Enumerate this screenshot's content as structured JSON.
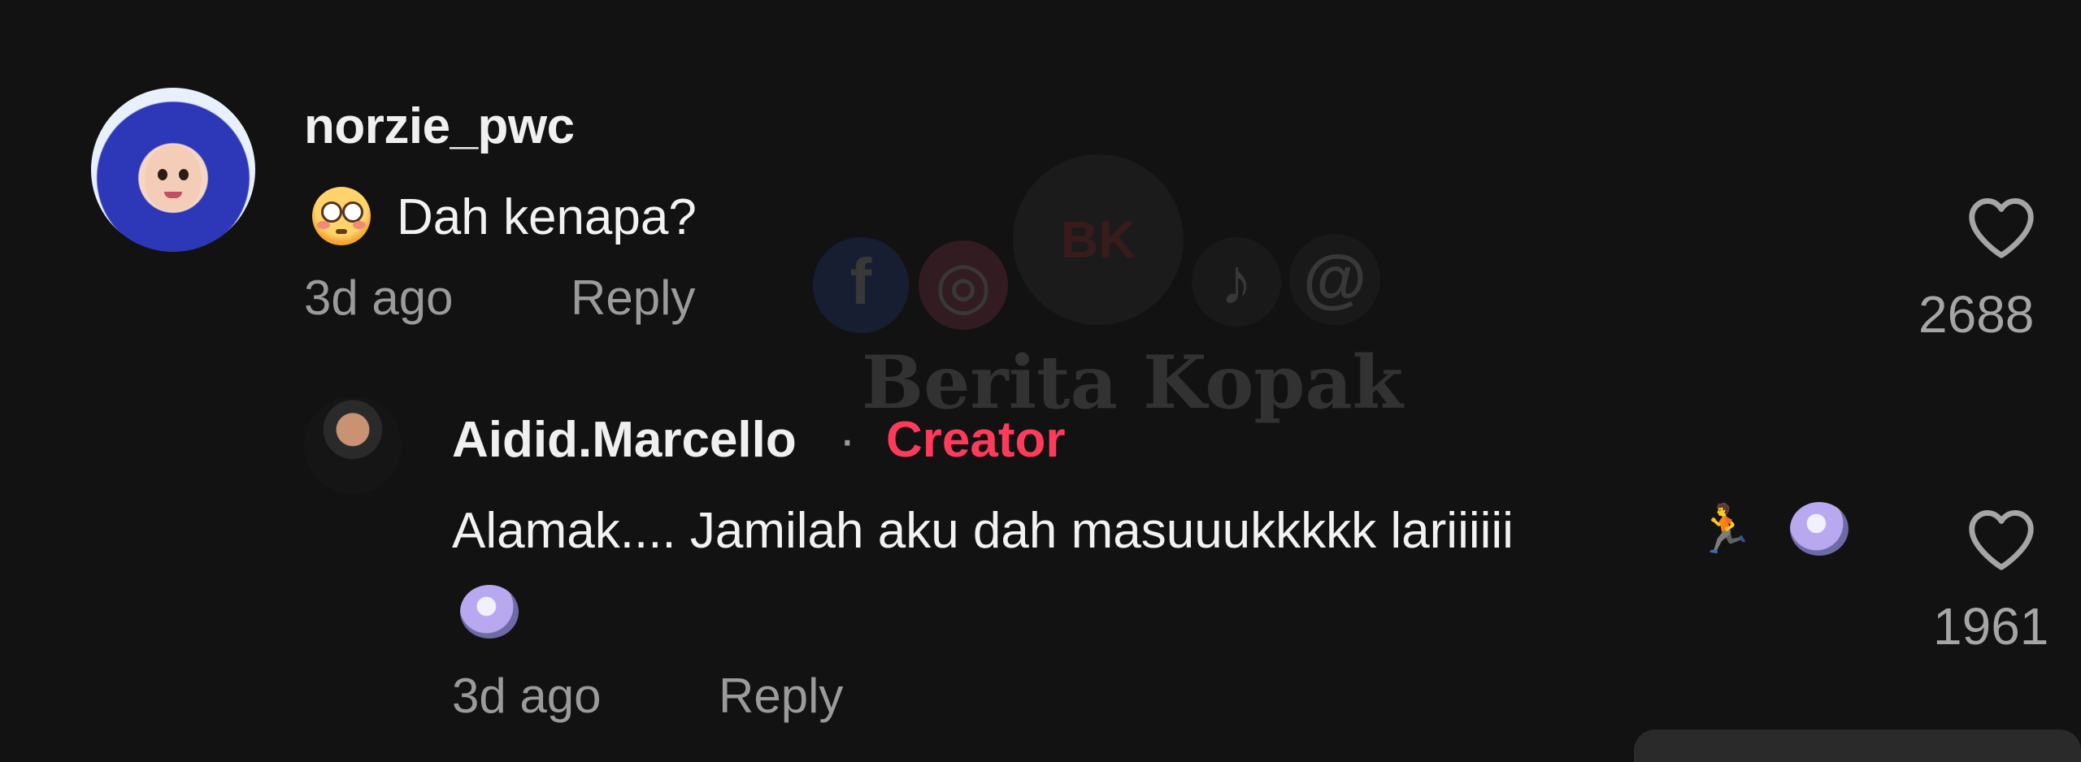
{
  "comments": [
    {
      "username": "norzie_pwc",
      "avatar_icon": "avatar-hijab-cartoon",
      "emoji": "flushed-face-emoji",
      "text": "Dah kenapa?",
      "time": "3d ago",
      "reply_label": "Reply",
      "likes": "2688"
    }
  ],
  "replies": [
    {
      "username": "Aidid.Marcello",
      "separator": "·",
      "badge": "Creator",
      "badge_color": "#ff3b5c",
      "text": "Alamak.... Jamilah aku dah masuuukkkkk lariiiiii",
      "emojis": [
        "person-running-emoji",
        "dashing-away-emoji",
        "dashing-away-emoji"
      ],
      "time": "3d ago",
      "reply_label": "Reply",
      "likes": "1961"
    }
  ],
  "watermark": {
    "brand": "Berita Kopak",
    "logo_text": "BK",
    "icons": [
      "facebook-icon",
      "instagram-icon",
      "tiktok-icon",
      "threads-icon"
    ]
  },
  "theme": {
    "background": "#121212",
    "muted_text": "#9b9b9b"
  }
}
